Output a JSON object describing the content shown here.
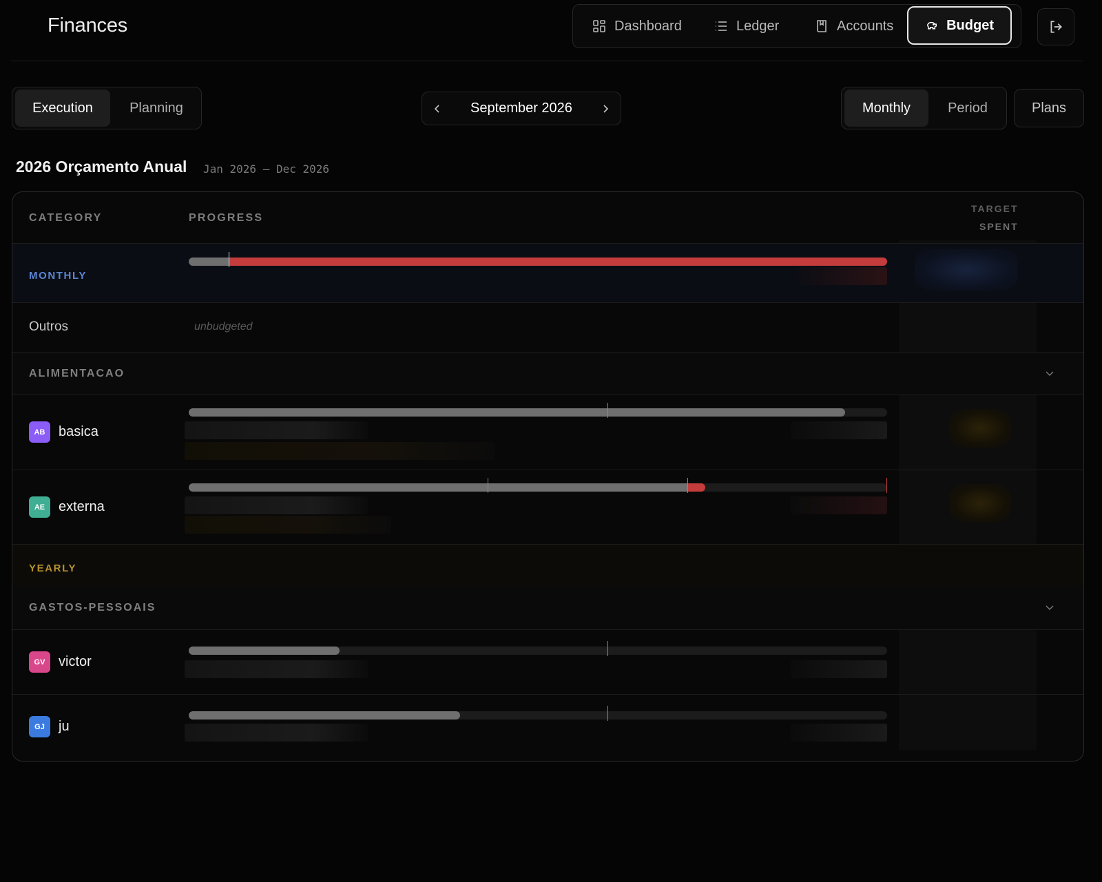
{
  "app": {
    "title": "Finances"
  },
  "nav": {
    "items": [
      {
        "label": "Dashboard",
        "icon": "grid-icon"
      },
      {
        "label": "Ledger",
        "icon": "list-icon"
      },
      {
        "label": "Accounts",
        "icon": "book-icon"
      },
      {
        "label": "Budget",
        "icon": "piggy-bank-icon",
        "active": true
      }
    ],
    "logout_icon": "logout-icon"
  },
  "toolbar": {
    "mode_tabs": [
      {
        "label": "Execution",
        "active": true
      },
      {
        "label": "Planning"
      }
    ],
    "month": {
      "label": "September 2026",
      "prev": "‹",
      "next": "›"
    },
    "view_tabs": [
      {
        "label": "Monthly",
        "active": true
      },
      {
        "label": "Period"
      }
    ],
    "plans_label": "Plans"
  },
  "plan": {
    "title": "2026 Orçamento Anual",
    "range": "Jan 2026 — Dec 2026"
  },
  "table": {
    "headers": {
      "category": "CATEGORY",
      "progress": "PROGRESS",
      "target": "TARGET",
      "spent": "SPENT"
    },
    "groups": {
      "monthly": {
        "label": "MONTHLY",
        "color": "#5b86d6",
        "progress": 1.0,
        "budget_marker": 0.057
      },
      "yearly": {
        "label": "YEARLY",
        "color": "#b8902e"
      }
    },
    "outros": {
      "name": "Outros",
      "note": "unbudgeted"
    },
    "categories": {
      "alimentacao": "ALIMENTACAO",
      "gastos_pessoais": "GASTOS-PESSOAIS"
    },
    "items": {
      "basica": {
        "name": "basica",
        "initials": "AB",
        "color": "#8b5cf6",
        "progress": 0.94,
        "marker": 0.6
      },
      "externa": {
        "name": "externa",
        "initials": "AE",
        "color": "#3fae93",
        "progress_gray": 0.715,
        "progress_red": 0.74,
        "markers": [
          0.428,
          0.714
        ]
      },
      "victor": {
        "name": "victor",
        "initials": "GV",
        "color": "#d9478b",
        "progress": 0.216,
        "marker": 0.6
      },
      "ju": {
        "name": "ju",
        "initials": "GJ",
        "color": "#3b7be0",
        "progress": 0.389,
        "marker": 0.6
      }
    }
  },
  "colors": {
    "overspend": "#c43c3c",
    "bar": "#6f6f6f",
    "track": "#1c1c1c"
  }
}
